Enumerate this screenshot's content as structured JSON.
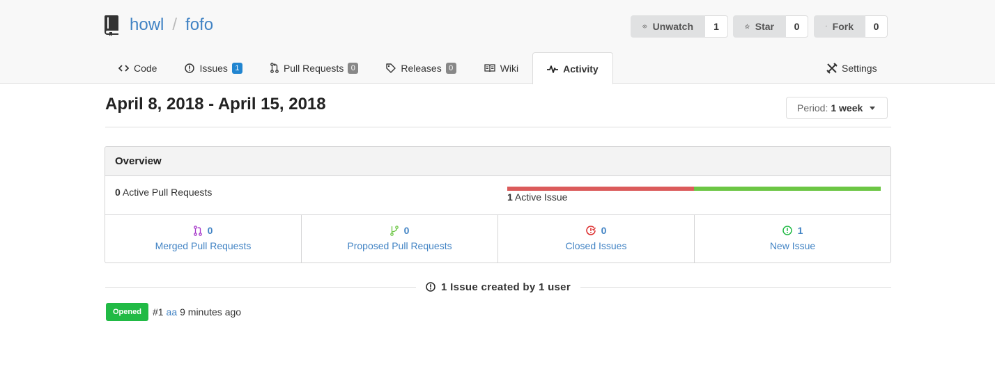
{
  "repo": {
    "owner": "howl",
    "separator": "/",
    "name": "fofo"
  },
  "actions": {
    "watch": {
      "label": "Unwatch",
      "count": "1"
    },
    "star": {
      "label": "Star",
      "count": "0"
    },
    "fork": {
      "label": "Fork",
      "count": "0"
    }
  },
  "tabs": [
    {
      "label": "Code",
      "icon": "code-icon"
    },
    {
      "label": "Issues",
      "icon": "issue-icon",
      "badge": "1",
      "badge_color": "#2185d0"
    },
    {
      "label": "Pull Requests",
      "icon": "pull-request-icon",
      "badge": "0",
      "badge_color": "#888888"
    },
    {
      "label": "Releases",
      "icon": "tag-icon",
      "badge": "0",
      "badge_color": "#888888"
    },
    {
      "label": "Wiki",
      "icon": "book-icon"
    },
    {
      "label": "Activity",
      "icon": "pulse-icon",
      "active": true
    }
  ],
  "settings": {
    "label": "Settings",
    "icon": "tools-icon"
  },
  "period": {
    "title": "April 8, 2018 - April 15, 2018",
    "prefix": "Period:",
    "value": "1 week"
  },
  "overview": {
    "heading": "Overview",
    "active_prs": {
      "count": "0",
      "label": "Active Pull Requests"
    },
    "active_issues": {
      "count": "1",
      "label": "Active Issue",
      "closed_fraction": 0.5
    },
    "stats": [
      {
        "count": "0",
        "label": "Merged Pull Requests",
        "icon": "git-merge-icon",
        "color": "#a333c8"
      },
      {
        "count": "0",
        "label": "Proposed Pull Requests",
        "icon": "git-branch-icon",
        "color": "#6cc644"
      },
      {
        "count": "0",
        "label": "Closed Issues",
        "icon": "issue-closed-icon",
        "color": "#db2828"
      },
      {
        "count": "1",
        "label": "New Issue",
        "icon": "issue-opened-icon",
        "color": "#21ba45"
      }
    ]
  },
  "issues_summary": "1 Issue created by 1 user",
  "issue_entries": [
    {
      "status": "Opened",
      "number": "#1",
      "title": "aa",
      "time": "9 minutes ago"
    }
  ],
  "colors": {
    "link": "#4183c4",
    "opened": "#21ba45"
  }
}
